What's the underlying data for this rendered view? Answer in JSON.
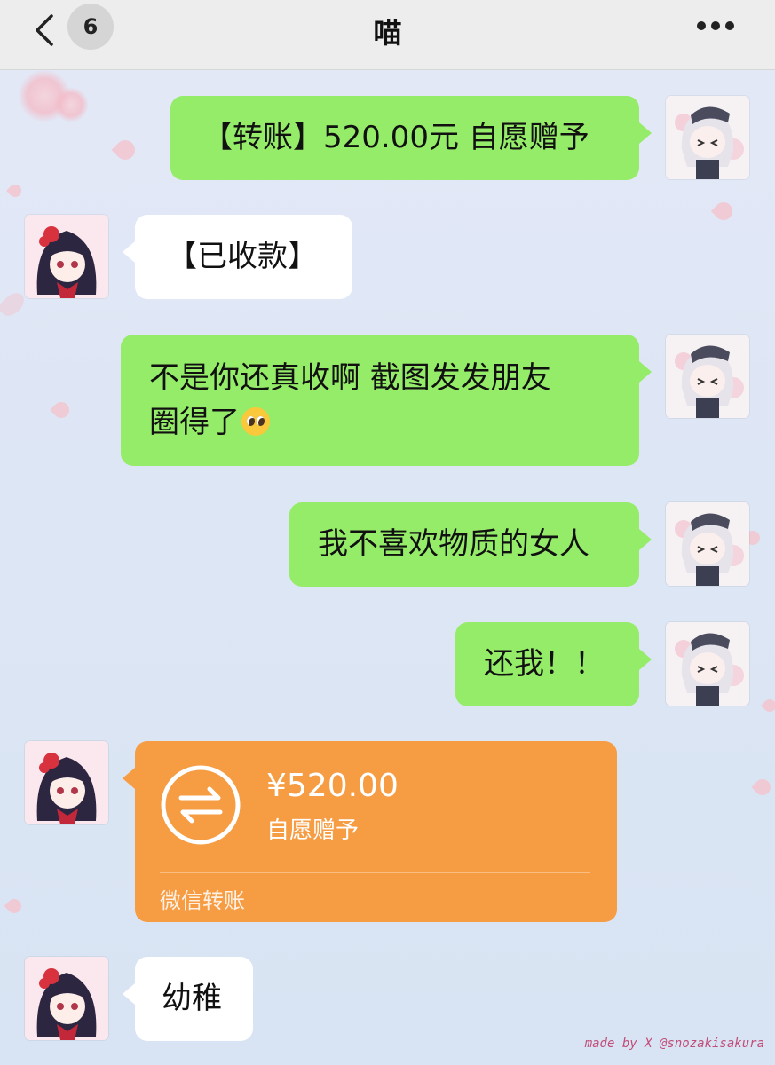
{
  "header": {
    "unread_count": "6",
    "title": "喵"
  },
  "messages": [
    {
      "side": "me",
      "text": "【转账】520.00元 自愿赠予"
    },
    {
      "side": "her",
      "text": "【已收款】"
    },
    {
      "side": "me",
      "text_line1": "不是你还真收啊 截图发发朋友",
      "text_line2": "圈得了"
    },
    {
      "side": "me",
      "text": "我不喜欢物质的女人"
    },
    {
      "side": "me",
      "text": "还我！！"
    },
    {
      "side": "her",
      "transfer": {
        "amount": "¥520.00",
        "note": "自愿赠予",
        "label": "微信转账"
      }
    },
    {
      "side": "her",
      "text": "幼稚"
    }
  ],
  "emoji": "pleading-face",
  "watermark": "made by X @snozakisakura",
  "colors": {
    "my_bubble": "#95ec69",
    "her_bubble": "#ffffff",
    "transfer": "#f69c43",
    "header": "#ededed"
  }
}
